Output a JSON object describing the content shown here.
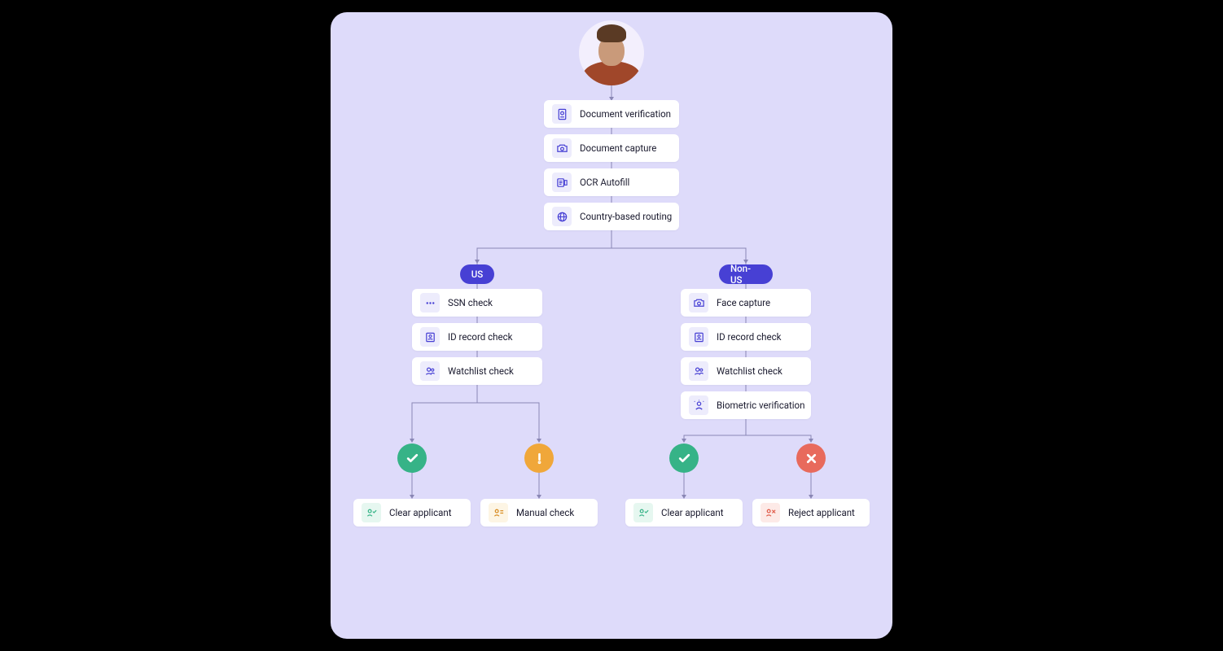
{
  "colors": {
    "panel": "#DEDBFA",
    "accent": "#4740D4",
    "success": "#36B387",
    "warning": "#F0A73A",
    "error": "#E86A5C"
  },
  "root_steps": [
    {
      "icon": "passport-icon",
      "label": "Document verification"
    },
    {
      "icon": "camera-icon",
      "label": "Document capture"
    },
    {
      "icon": "ocr-icon",
      "label": "OCR Autofill"
    },
    {
      "icon": "globe-icon",
      "label": "Country-based routing"
    }
  ],
  "branches": [
    {
      "pill": "US",
      "steps": [
        {
          "icon": "ssn-icon",
          "label": "SSN check"
        },
        {
          "icon": "id-record-icon",
          "label": "ID record check"
        },
        {
          "icon": "watchlist-icon",
          "label": "Watchlist check"
        }
      ]
    },
    {
      "pill": "Non-US",
      "steps": [
        {
          "icon": "camera-icon",
          "label": "Face capture"
        },
        {
          "icon": "id-record-icon",
          "label": "ID record check"
        },
        {
          "icon": "watchlist-icon",
          "label": "Watchlist check"
        },
        {
          "icon": "biometric-icon",
          "label": "Biometric verification"
        }
      ]
    }
  ],
  "outcomes": [
    {
      "status": "success",
      "icon": "clear-icon",
      "label": "Clear applicant"
    },
    {
      "status": "warning",
      "icon": "manual-icon",
      "label": "Manual check"
    },
    {
      "status": "success",
      "icon": "clear-icon",
      "label": "Clear applicant"
    },
    {
      "status": "error",
      "icon": "reject-icon",
      "label": "Reject applicant"
    }
  ]
}
